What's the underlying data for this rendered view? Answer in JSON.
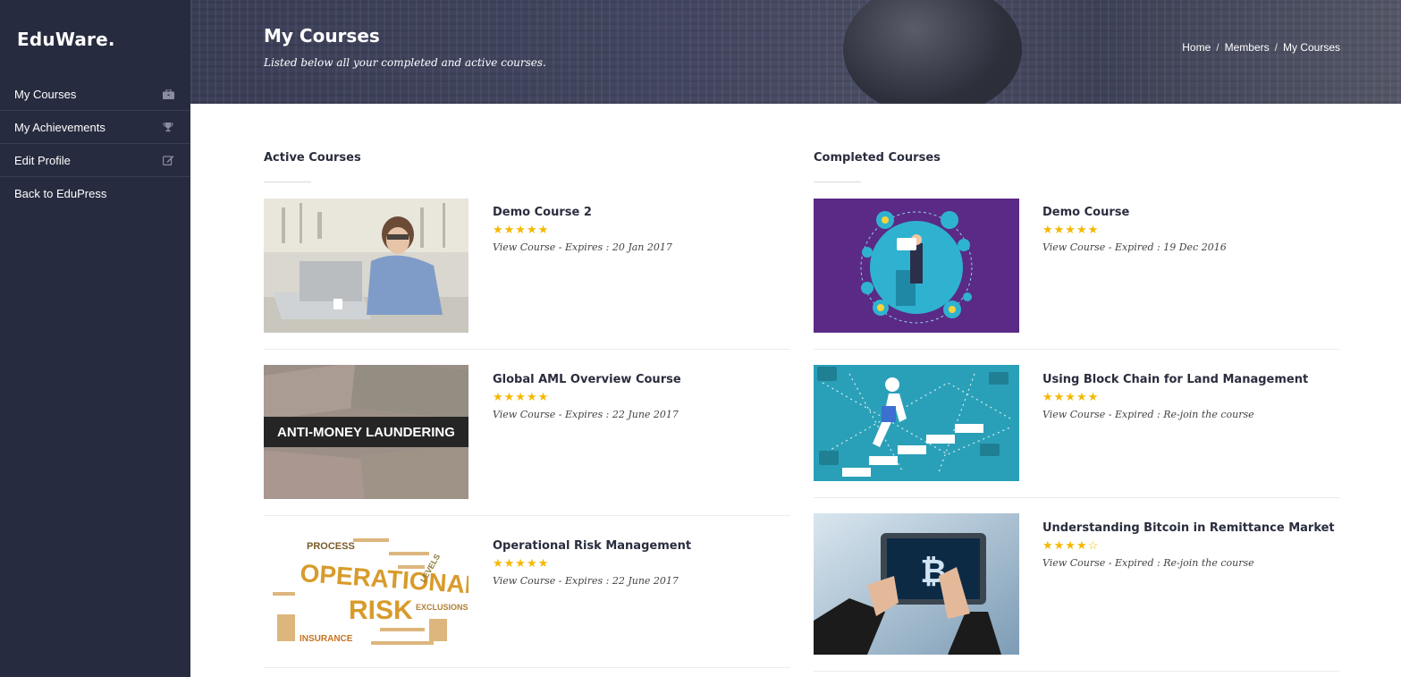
{
  "sidebar": {
    "brand": "EduWare.",
    "items": [
      {
        "label": "My Courses",
        "icon": "briefcase-icon"
      },
      {
        "label": "My Achievements",
        "icon": "trophy-icon"
      },
      {
        "label": "Edit Profile",
        "icon": "edit-icon"
      },
      {
        "label": "Back to EduPress",
        "icon": ""
      }
    ]
  },
  "header": {
    "title": "My Courses",
    "subtitle": "Listed below all your completed and active courses.",
    "breadcrumb": [
      "Home",
      "Members",
      "My Courses"
    ]
  },
  "active": {
    "title": "Active Courses",
    "courses": [
      {
        "title": "Demo Course 2",
        "rating": 5,
        "stars": "★★★★★",
        "link": "View Course",
        "status": " - Expires : 20 Jan 2017",
        "image": "woman-at-laptop"
      },
      {
        "title": "Global AML Overview Course",
        "rating": 5,
        "stars": "★★★★★",
        "link": "View Course",
        "status": " - Expires : 22 June 2017",
        "image": "anti-money-laundering",
        "image_text": "ANTI-MONEY LAUNDERING"
      },
      {
        "title": "Operational Risk Management",
        "rating": 5,
        "stars": "★★★★★",
        "link": "View Course",
        "status": " - Expires : 22 June 2017",
        "image": "operational-risk-wordcloud",
        "image_words": [
          "OPERATIONAL",
          "RISK",
          "PROCESS",
          "INSURANCE",
          "LEVELS",
          "EXCLUSIONS"
        ]
      }
    ]
  },
  "completed": {
    "title": "Completed Courses",
    "courses": [
      {
        "title": "Demo Course",
        "rating": 5,
        "stars": "★★★★★",
        "link": "View Course",
        "status": " - Expired : 19 Dec 2016",
        "image": "speaker-infographic"
      },
      {
        "title": "Using Block Chain for Land Management",
        "rating": 5,
        "stars": "★★★★★",
        "link": "View Course",
        "status": " - Expired : Re-join the course",
        "image": "blockchain-steps"
      },
      {
        "title": "Understanding Bitcoin in Remittance Market",
        "rating": 4,
        "stars": "★★★★☆",
        "link": "View Course",
        "status": " - Expired : Re-join the course",
        "image": "bitcoin-tablet"
      }
    ]
  },
  "colors": {
    "sidebar": "#272b3f",
    "star": "#f5b800",
    "heading": "#2a2d3e"
  }
}
